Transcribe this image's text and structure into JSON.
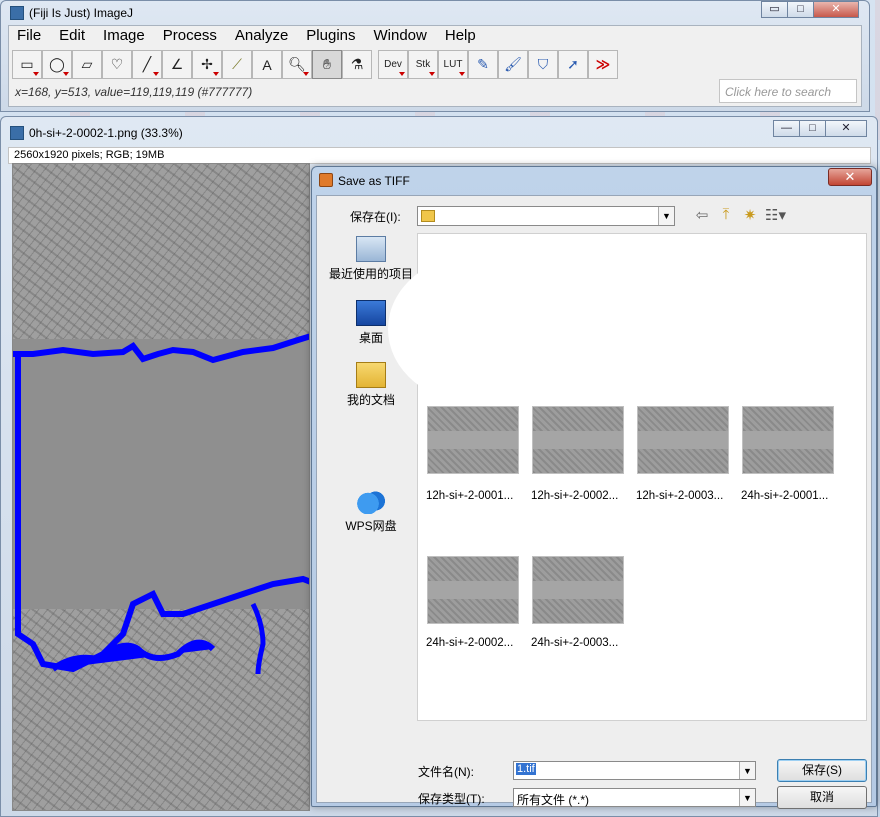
{
  "main_window": {
    "title": "(Fiji Is Just) ImageJ",
    "menus": [
      "File",
      "Edit",
      "Image",
      "Process",
      "Analyze",
      "Plugins",
      "Window",
      "Help"
    ],
    "tool_labels": {
      "text": "A",
      "dev": "Dev",
      "stk": "Stk",
      "lut": "LUT",
      "more": "≫"
    },
    "status": "x=168, y=513, value=119,119,119 (#777777)",
    "search_placeholder": "Click here to search",
    "controls": {
      "minimize": "▭",
      "maximize": "□",
      "close": "✕"
    }
  },
  "image_window": {
    "title": "0h-si+-2-0002-1.png (33.3%)",
    "info": "2560x1920 pixels; RGB; 19MB",
    "controls": {
      "minimize": "—",
      "maximize": "□",
      "close": "✕"
    },
    "overlay_color": "#0000ff"
  },
  "dialog": {
    "title": "Save as TIFF",
    "close": "✕",
    "look_in_label": "保存在(I):",
    "places": [
      {
        "label": "最近使用的项目",
        "icon": "recent-places-icon"
      },
      {
        "label": "桌面",
        "icon": "desktop-icon"
      },
      {
        "label": "我的文档",
        "icon": "documents-icon"
      },
      {
        "label": "WPS网盘",
        "icon": "wps-cloud-icon"
      }
    ],
    "files": [
      {
        "name": "12h-si+-2-0001..."
      },
      {
        "name": "12h-si+-2-0002..."
      },
      {
        "name": "12h-si+-2-0003..."
      },
      {
        "name": "24h-si+-2-0001..."
      },
      {
        "name": "24h-si+-2-0002..."
      },
      {
        "name": "24h-si+-2-0003..."
      }
    ],
    "file_name_label": "文件名(N):",
    "file_name_value": "1.tif",
    "file_type_label": "保存类型(T):",
    "file_type_value": "所有文件 (*.*)",
    "save_button": "保存(S)",
    "cancel_button": "取消"
  }
}
